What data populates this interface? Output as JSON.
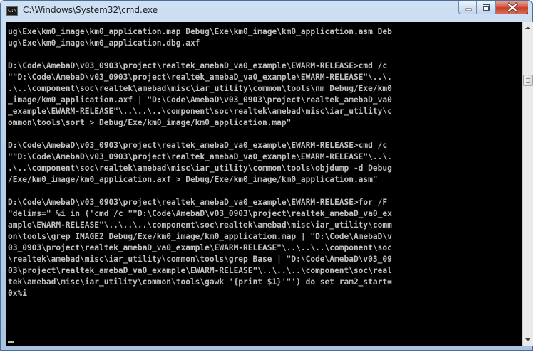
{
  "window": {
    "title": "C:\\Windows\\System32\\cmd.exe",
    "icon": "cmd-icon",
    "icon_text": "C:\\"
  },
  "controls": {
    "minimize": "minimize-icon",
    "maximize": "maximize-icon",
    "close": "close-icon"
  },
  "console": {
    "lines": [
      "ug\\Exe\\km0_image\\km0_application.map Debug\\Exe\\km0_image\\km0_application.asm Deb",
      "ug\\Exe\\km0_image\\km0_application.dbg.axf",
      "",
      "D:\\Code\\AmebaD\\v03_0903\\project\\realtek_amebaD_va0_example\\EWARM-RELEASE>cmd /c",
      "\"\"D:\\Code\\AmebaD\\v03_0903\\project\\realtek_amebaD_va0_example\\EWARM-RELEASE\"\\..\\.",
      ".\\..\\component\\soc\\realtek\\amebad\\misc\\iar_utility\\common\\tools\\nm Debug/Exe/km0",
      "_image/km0_application.axf | \"D:\\Code\\AmebaD\\v03_0903\\project\\realtek_amebaD_va0",
      "_example\\EWARM-RELEASE\"\\..\\..\\..\\component\\soc\\realtek\\amebad\\misc\\iar_utility\\c",
      "ommon\\tools\\sort > Debug/Exe/km0_image/km0_application.map\"",
      "",
      "D:\\Code\\AmebaD\\v03_0903\\project\\realtek_amebaD_va0_example\\EWARM-RELEASE>cmd /c",
      "\"\"D:\\Code\\AmebaD\\v03_0903\\project\\realtek_amebaD_va0_example\\EWARM-RELEASE\"\\..\\.",
      ".\\..\\component\\soc\\realtek\\amebad\\misc\\iar_utility\\common\\tools\\objdump -d Debug",
      "/Exe/km0_image/km0_application.axf > Debug/Exe/km0_image/km0_application.asm\"",
      "",
      "D:\\Code\\AmebaD\\v03_0903\\project\\realtek_amebaD_va0_example\\EWARM-RELEASE>for /F",
      "\"delims=\" %i in ('cmd /c \"\"D:\\Code\\AmebaD\\v03_0903\\project\\realtek_amebaD_va0_ex",
      "ample\\EWARM-RELEASE\"\\..\\..\\..\\component\\soc\\realtek\\amebad\\misc\\iar_utility\\comm",
      "on\\tools\\grep IMAGE2 Debug/Exe/km0_image/km0_application.map | \"D:\\Code\\AmebaD\\v",
      "03_0903\\project\\realtek_amebaD_va0_example\\EWARM-RELEASE\"\\..\\..\\..\\component\\soc",
      "\\realtek\\amebad\\misc\\iar_utility\\common\\tools\\grep Base | \"D:\\Code\\AmebaD\\v03_09",
      "03\\project\\realtek_amebaD_va0_example\\EWARM-RELEASE\"\\..\\..\\..\\component\\soc\\real",
      "tek\\amebad\\misc\\iar_utility\\common\\tools\\gawk '{print $1}'\"') do set ram2_start=",
      "0x%i"
    ]
  },
  "scrollbar": {
    "up": "scroll-up-arrow-icon",
    "down": "scroll-down-arrow-icon",
    "position": 0.08
  },
  "colors": {
    "console_bg": "#000000",
    "console_fg": "#c0c0c0",
    "close_button": "#c4402a"
  }
}
